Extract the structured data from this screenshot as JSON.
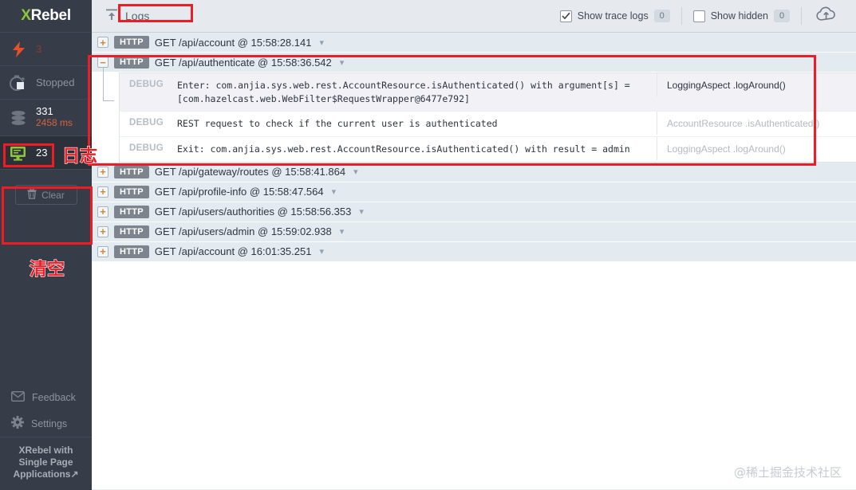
{
  "sidebar": {
    "logo": {
      "x": "X",
      "rest": "Rebel"
    },
    "stats": [
      {
        "icon": "lightning-bolt-icon",
        "value": "3",
        "label": ""
      },
      {
        "icon": "stopwatch-stop-icon",
        "value": "",
        "label": "Stopped"
      },
      {
        "icon": "database-icon",
        "value": "331",
        "sub": "2458 ms"
      },
      {
        "icon": "console-logs-icon",
        "value": "23",
        "label": ""
      }
    ],
    "clear_button": "Clear",
    "links": [
      {
        "icon": "envelope-icon",
        "label": "Feedback"
      },
      {
        "icon": "gear-icon",
        "label": "Settings"
      }
    ],
    "promo": "XRebel with Single Page Applications↗"
  },
  "topbar": {
    "title": "Logs",
    "show_trace_logs": {
      "label": "Show trace logs",
      "count": "0",
      "checked": true
    },
    "show_hidden": {
      "label": "Show hidden",
      "count": "0",
      "checked": false
    },
    "upload_icon": "cloud-upload-icon"
  },
  "logs": [
    {
      "expanded": false,
      "method": "HTTP",
      "text": "GET /api/account @ 15:58:28.141"
    },
    {
      "expanded": true,
      "method": "HTTP",
      "text": "GET /api/authenticate @ 15:58:36.542"
    },
    {
      "expanded": false,
      "method": "HTTP",
      "text": "GET /api/gateway/routes @ 15:58:41.864"
    },
    {
      "expanded": false,
      "method": "HTTP",
      "text": "GET /api/profile-info @ 15:58:47.564"
    },
    {
      "expanded": false,
      "method": "HTTP",
      "text": "GET /api/users/authorities @ 15:58:56.353"
    },
    {
      "expanded": false,
      "method": "HTTP",
      "text": "GET /api/users/admin @ 15:59:02.938"
    },
    {
      "expanded": false,
      "method": "HTTP",
      "text": "GET /api/account @ 16:01:35.251"
    }
  ],
  "detail_rows": [
    {
      "level": "DEBUG",
      "message": "Enter: com.anjia.sys.web.rest.AccountResource.isAuthenticated() with argument[s] = [com.hazelcast.web.WebFilter$RequestWrapper@6477e792]",
      "source": "LoggingAspect .logAround()",
      "highlight": true
    },
    {
      "level": "DEBUG",
      "message": "REST request to check if the current user is authenticated",
      "source": "AccountResource .isAuthenticated()",
      "highlight": false
    },
    {
      "level": "DEBUG",
      "message": "Exit: com.anjia.sys.web.rest.AccountResource.isAuthenticated() with result = admin",
      "source": "LoggingAspect .logAround()",
      "highlight": false
    }
  ],
  "annotations": {
    "logs_label": "日志",
    "clear_label": "清空"
  },
  "watermark": "@稀土掘金技术社区",
  "colors": {
    "sidebar_bg": "#373d48",
    "accent_green": "#8cc63e",
    "annotation_red": "#ee1c25",
    "row_bg": "#e3eaf0",
    "orange": "#d4623c"
  }
}
